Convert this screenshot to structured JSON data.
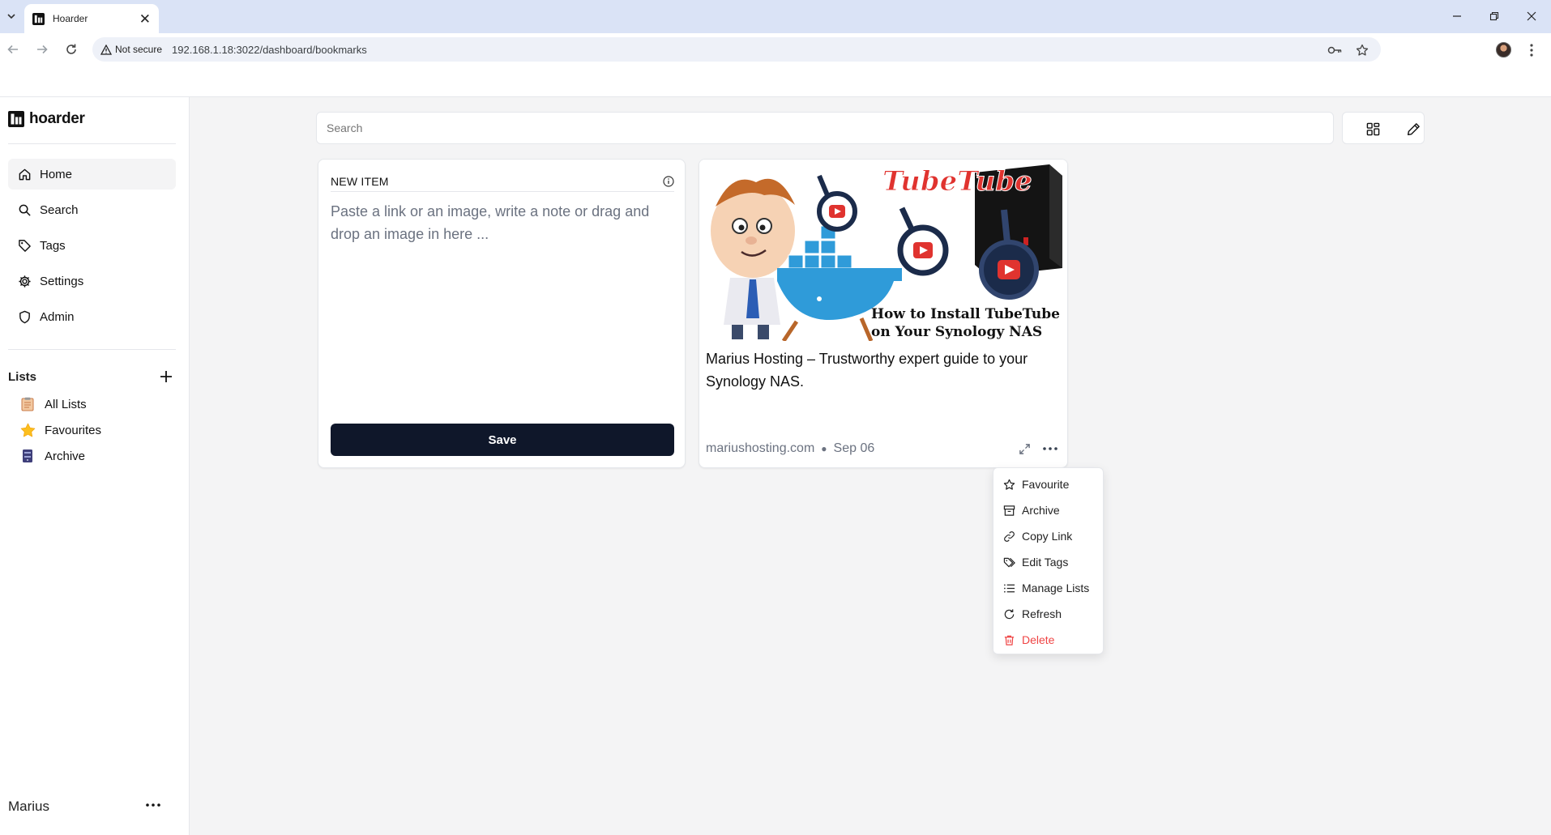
{
  "browser": {
    "tab_title": "Hoarder",
    "security_label": "Not secure",
    "url": "192.168.1.18:3022/dashboard/bookmarks"
  },
  "sidebar": {
    "brand": "hoarder",
    "nav": [
      {
        "label": "Home",
        "icon": "home-icon"
      },
      {
        "label": "Search",
        "icon": "search-icon"
      },
      {
        "label": "Tags",
        "icon": "tag-icon"
      },
      {
        "label": "Settings",
        "icon": "gear-icon"
      },
      {
        "label": "Admin",
        "icon": "shield-icon"
      }
    ],
    "lists_title": "Lists",
    "lists": [
      {
        "label": "All Lists",
        "emoji": "clipboard"
      },
      {
        "label": "Favourites",
        "emoji": "star"
      },
      {
        "label": "Archive",
        "emoji": "storage"
      }
    ],
    "user_name": "Marius"
  },
  "main": {
    "search_placeholder": "Search"
  },
  "new_item": {
    "header": "NEW ITEM",
    "placeholder": "Paste a link or an image, write a note or drag and drop an image in here ...",
    "save_label": "Save"
  },
  "bookmark": {
    "image_headline": "TubeTube",
    "image_caption_1": "How to Install TubeTube",
    "image_caption_2": "on Your Synology NAS",
    "title": "Marius Hosting – Trustworthy expert guide to your Synology NAS.",
    "domain": "mariushosting.com",
    "date": "Sep 06"
  },
  "menu": {
    "items": [
      {
        "label": "Favourite",
        "icon": "star-icon"
      },
      {
        "label": "Archive",
        "icon": "archive-icon"
      },
      {
        "label": "Copy Link",
        "icon": "link-icon"
      },
      {
        "label": "Edit Tags",
        "icon": "tags-icon"
      },
      {
        "label": "Manage Lists",
        "icon": "list-icon"
      },
      {
        "label": "Refresh",
        "icon": "refresh-icon"
      },
      {
        "label": "Delete",
        "icon": "trash-icon"
      }
    ]
  },
  "colors": {
    "primary": "#0f172a",
    "danger": "#ef4444",
    "main_bg": "#f4f4f5",
    "tabstrip": "#dae3f6"
  }
}
